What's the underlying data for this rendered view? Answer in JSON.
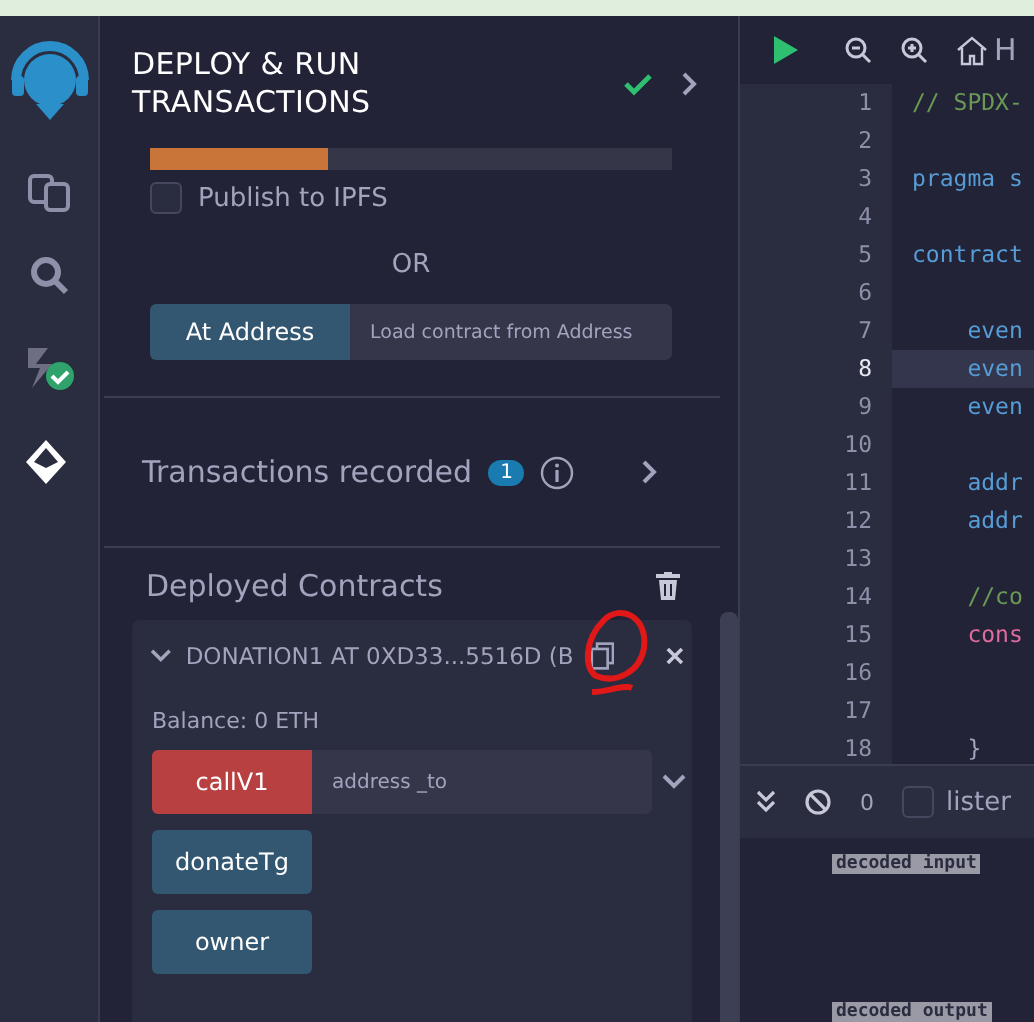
{
  "panel": {
    "title": "DEPLOY & RUN TRANSACTIONS",
    "compiled": true
  },
  "publish": {
    "level": 0.34,
    "label": "Publish to IPFS",
    "checked": false
  },
  "or_label": "OR",
  "at_address": {
    "button": "At Address",
    "placeholder": "Load contract from Address"
  },
  "transactions": {
    "label": "Transactions recorded",
    "count": "1"
  },
  "deployed": {
    "title": "Deployed Contracts",
    "contract": {
      "name": "DONATION1 AT 0XD33...5516D (B",
      "expanded": true,
      "balance": "Balance: 0 ETH",
      "functions": [
        {
          "label": "callV1",
          "kind": "transact",
          "placeholder": "address _to"
        },
        {
          "label": "donateTg",
          "kind": "call"
        },
        {
          "label": "owner",
          "kind": "call"
        }
      ]
    }
  },
  "editor": {
    "tab_label": "H",
    "lines": [
      {
        "number": "1",
        "code": "// SPDX-",
        "kind": "comment",
        "selected": false
      },
      {
        "number": "2",
        "selected": false
      },
      {
        "number": "3",
        "code": "pragma s",
        "kind": "keyword",
        "selected": false
      },
      {
        "number": "4",
        "selected": false
      },
      {
        "number": "5",
        "code": "contract",
        "kind": "keyword",
        "selected": false
      },
      {
        "number": "6",
        "selected": false
      },
      {
        "number": "7",
        "code": "    even",
        "kind": "keyword",
        "selected": false
      },
      {
        "number": "8",
        "code": "    even",
        "kind": "keyword",
        "selected": true
      },
      {
        "number": "9",
        "code": "    even",
        "kind": "keyword",
        "selected": false
      },
      {
        "number": "10",
        "selected": false
      },
      {
        "number": "11",
        "code": "    addr",
        "kind": "keyword",
        "selected": false
      },
      {
        "number": "12",
        "code": "    addr",
        "kind": "keyword",
        "selected": false
      },
      {
        "number": "13",
        "selected": false
      },
      {
        "number": "14",
        "code": "    //co",
        "kind": "comment",
        "selected": false
      },
      {
        "number": "15",
        "code": "    cons",
        "kind": "special",
        "selected": false
      },
      {
        "number": "16",
        "selected": false
      },
      {
        "number": "17",
        "selected": false
      },
      {
        "number": "18",
        "code": "    }",
        "kind": "plain",
        "selected": false
      }
    ]
  },
  "terminal": {
    "count": "0",
    "filter_label": "lister",
    "filter_checked": false,
    "logs": [
      "decoded input",
      "decoded output"
    ]
  }
}
